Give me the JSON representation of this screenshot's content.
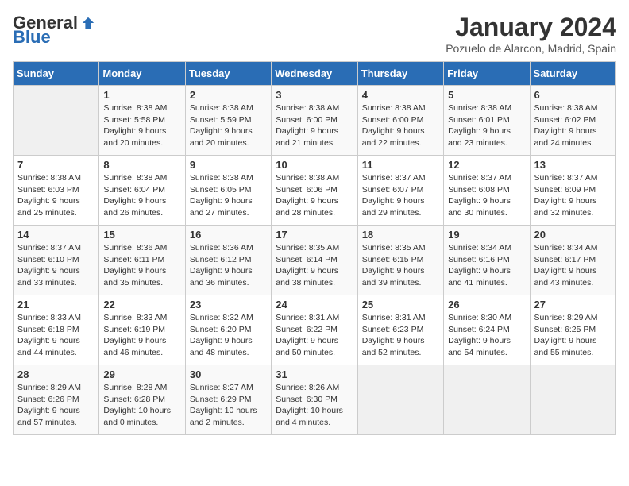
{
  "logo": {
    "general": "General",
    "blue": "Blue"
  },
  "title": "January 2024",
  "location": "Pozuelo de Alarcon, Madrid, Spain",
  "days_header": [
    "Sunday",
    "Monday",
    "Tuesday",
    "Wednesday",
    "Thursday",
    "Friday",
    "Saturday"
  ],
  "weeks": [
    [
      {
        "num": "",
        "info": ""
      },
      {
        "num": "1",
        "info": "Sunrise: 8:38 AM\nSunset: 5:58 PM\nDaylight: 9 hours\nand 20 minutes."
      },
      {
        "num": "2",
        "info": "Sunrise: 8:38 AM\nSunset: 5:59 PM\nDaylight: 9 hours\nand 20 minutes."
      },
      {
        "num": "3",
        "info": "Sunrise: 8:38 AM\nSunset: 6:00 PM\nDaylight: 9 hours\nand 21 minutes."
      },
      {
        "num": "4",
        "info": "Sunrise: 8:38 AM\nSunset: 6:00 PM\nDaylight: 9 hours\nand 22 minutes."
      },
      {
        "num": "5",
        "info": "Sunrise: 8:38 AM\nSunset: 6:01 PM\nDaylight: 9 hours\nand 23 minutes."
      },
      {
        "num": "6",
        "info": "Sunrise: 8:38 AM\nSunset: 6:02 PM\nDaylight: 9 hours\nand 24 minutes."
      }
    ],
    [
      {
        "num": "7",
        "info": "Sunrise: 8:38 AM\nSunset: 6:03 PM\nDaylight: 9 hours\nand 25 minutes."
      },
      {
        "num": "8",
        "info": "Sunrise: 8:38 AM\nSunset: 6:04 PM\nDaylight: 9 hours\nand 26 minutes."
      },
      {
        "num": "9",
        "info": "Sunrise: 8:38 AM\nSunset: 6:05 PM\nDaylight: 9 hours\nand 27 minutes."
      },
      {
        "num": "10",
        "info": "Sunrise: 8:38 AM\nSunset: 6:06 PM\nDaylight: 9 hours\nand 28 minutes."
      },
      {
        "num": "11",
        "info": "Sunrise: 8:37 AM\nSunset: 6:07 PM\nDaylight: 9 hours\nand 29 minutes."
      },
      {
        "num": "12",
        "info": "Sunrise: 8:37 AM\nSunset: 6:08 PM\nDaylight: 9 hours\nand 30 minutes."
      },
      {
        "num": "13",
        "info": "Sunrise: 8:37 AM\nSunset: 6:09 PM\nDaylight: 9 hours\nand 32 minutes."
      }
    ],
    [
      {
        "num": "14",
        "info": "Sunrise: 8:37 AM\nSunset: 6:10 PM\nDaylight: 9 hours\nand 33 minutes."
      },
      {
        "num": "15",
        "info": "Sunrise: 8:36 AM\nSunset: 6:11 PM\nDaylight: 9 hours\nand 35 minutes."
      },
      {
        "num": "16",
        "info": "Sunrise: 8:36 AM\nSunset: 6:12 PM\nDaylight: 9 hours\nand 36 minutes."
      },
      {
        "num": "17",
        "info": "Sunrise: 8:35 AM\nSunset: 6:14 PM\nDaylight: 9 hours\nand 38 minutes."
      },
      {
        "num": "18",
        "info": "Sunrise: 8:35 AM\nSunset: 6:15 PM\nDaylight: 9 hours\nand 39 minutes."
      },
      {
        "num": "19",
        "info": "Sunrise: 8:34 AM\nSunset: 6:16 PM\nDaylight: 9 hours\nand 41 minutes."
      },
      {
        "num": "20",
        "info": "Sunrise: 8:34 AM\nSunset: 6:17 PM\nDaylight: 9 hours\nand 43 minutes."
      }
    ],
    [
      {
        "num": "21",
        "info": "Sunrise: 8:33 AM\nSunset: 6:18 PM\nDaylight: 9 hours\nand 44 minutes."
      },
      {
        "num": "22",
        "info": "Sunrise: 8:33 AM\nSunset: 6:19 PM\nDaylight: 9 hours\nand 46 minutes."
      },
      {
        "num": "23",
        "info": "Sunrise: 8:32 AM\nSunset: 6:20 PM\nDaylight: 9 hours\nand 48 minutes."
      },
      {
        "num": "24",
        "info": "Sunrise: 8:31 AM\nSunset: 6:22 PM\nDaylight: 9 hours\nand 50 minutes."
      },
      {
        "num": "25",
        "info": "Sunrise: 8:31 AM\nSunset: 6:23 PM\nDaylight: 9 hours\nand 52 minutes."
      },
      {
        "num": "26",
        "info": "Sunrise: 8:30 AM\nSunset: 6:24 PM\nDaylight: 9 hours\nand 54 minutes."
      },
      {
        "num": "27",
        "info": "Sunrise: 8:29 AM\nSunset: 6:25 PM\nDaylight: 9 hours\nand 55 minutes."
      }
    ],
    [
      {
        "num": "28",
        "info": "Sunrise: 8:29 AM\nSunset: 6:26 PM\nDaylight: 9 hours\nand 57 minutes."
      },
      {
        "num": "29",
        "info": "Sunrise: 8:28 AM\nSunset: 6:28 PM\nDaylight: 10 hours\nand 0 minutes."
      },
      {
        "num": "30",
        "info": "Sunrise: 8:27 AM\nSunset: 6:29 PM\nDaylight: 10 hours\nand 2 minutes."
      },
      {
        "num": "31",
        "info": "Sunrise: 8:26 AM\nSunset: 6:30 PM\nDaylight: 10 hours\nand 4 minutes."
      },
      {
        "num": "",
        "info": ""
      },
      {
        "num": "",
        "info": ""
      },
      {
        "num": "",
        "info": ""
      }
    ]
  ]
}
